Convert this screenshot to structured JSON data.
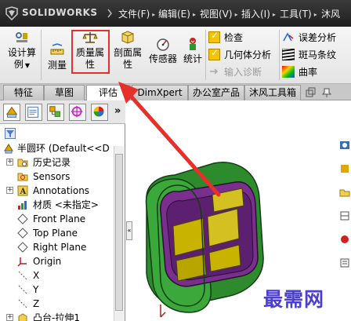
{
  "app": {
    "brand": "SOLIDWORKS"
  },
  "menu": {
    "items": [
      {
        "label": "文件(F)"
      },
      {
        "label": "编辑(E)"
      },
      {
        "label": "视图(V)"
      },
      {
        "label": "插入(I)"
      },
      {
        "label": "工具(T)"
      },
      {
        "label": "沐风"
      }
    ]
  },
  "ribbon": {
    "design_study": {
      "line1": "设计算",
      "line2": "例"
    },
    "measure": "测量",
    "mass_properties": {
      "line1": "质量属",
      "line2": "性"
    },
    "section_properties": {
      "line1": "剖面属",
      "line2": "性"
    },
    "sensor": "传感器",
    "statistics": "统计",
    "check": "检查",
    "geometry_analysis": "几何体分析",
    "import_diagnostics": "输入诊断",
    "deviation_analysis": "误差分析",
    "zebra_stripes": "斑马条纹",
    "curvature": "曲率"
  },
  "tabs": [
    {
      "label": "特征"
    },
    {
      "label": "草图"
    },
    {
      "label": "评估"
    },
    {
      "label": "DimXpert"
    },
    {
      "label": "办公室产品"
    },
    {
      "label": "沐风工具箱"
    }
  ],
  "tree": {
    "root": "半圆环  (Default<<D",
    "items": [
      {
        "label": "历史记录"
      },
      {
        "label": "Sensors"
      },
      {
        "label": "Annotations"
      },
      {
        "label": "材质 <未指定>"
      },
      {
        "label": "Front Plane"
      },
      {
        "label": "Top Plane"
      },
      {
        "label": "Right Plane"
      },
      {
        "label": "Origin"
      },
      {
        "label": "X"
      },
      {
        "label": "Y"
      },
      {
        "label": "Z"
      },
      {
        "label": "凸台-拉伸1"
      }
    ]
  },
  "watermark": "最需网",
  "colors": {
    "highlight": "#e8302a",
    "arrow": "#e8302a",
    "part_green": "#2e8b2e",
    "part_purple": "#7a2f8f",
    "part_yellow": "#c8b400",
    "watermark": "#4a3fd0"
  },
  "panel_glyphs": {
    "expand": "»"
  },
  "ribbon_glyphs": {
    "design_study_arrow": "▼"
  }
}
